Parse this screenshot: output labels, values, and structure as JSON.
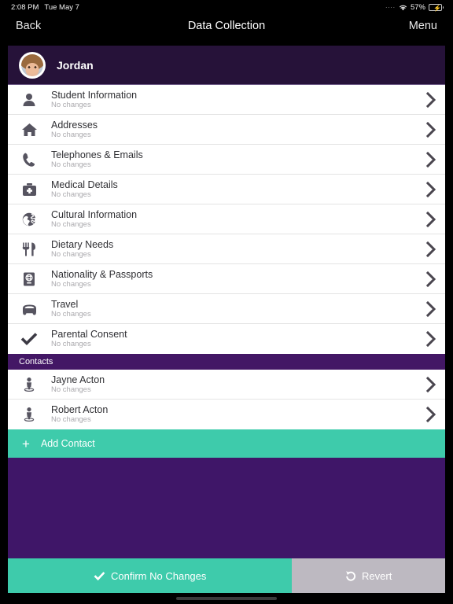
{
  "statusbar": {
    "time": "2:08 PM",
    "date": "Tue May 7",
    "signal_dots": "....",
    "wifi_icon": "wifi-icon",
    "battery_percent": "57%",
    "battery_level": 57,
    "battery_charging": true
  },
  "navbar": {
    "back_label": "Back",
    "title": "Data Collection",
    "menu_label": "Menu"
  },
  "profile": {
    "name": "Jordan",
    "avatar_alt": "student-photo"
  },
  "sections": [
    {
      "id": "details",
      "header": null,
      "rows": [
        {
          "icon": "person-icon",
          "title": "Student Information",
          "subtitle": "No changes"
        },
        {
          "icon": "home-icon",
          "title": "Addresses",
          "subtitle": "No changes"
        },
        {
          "icon": "phone-icon",
          "title": "Telephones & Emails",
          "subtitle": "No changes"
        },
        {
          "icon": "medkit-icon",
          "title": "Medical Details",
          "subtitle": "No changes"
        },
        {
          "icon": "globe-icon",
          "title": "Cultural Information",
          "subtitle": "No changes"
        },
        {
          "icon": "cutlery-icon",
          "title": "Dietary Needs",
          "subtitle": "No changes"
        },
        {
          "icon": "passport-icon",
          "title": "Nationality & Passports",
          "subtitle": "No changes"
        },
        {
          "icon": "car-icon",
          "title": "Travel",
          "subtitle": "No changes"
        },
        {
          "icon": "check-icon",
          "title": "Parental Consent",
          "subtitle": "No changes"
        }
      ]
    },
    {
      "id": "contacts",
      "header": "Contacts",
      "rows": [
        {
          "icon": "contact-person-icon",
          "title": "Jayne Acton",
          "subtitle": "No changes"
        },
        {
          "icon": "contact-person-icon",
          "title": "Robert Acton",
          "subtitle": "No changes"
        }
      ]
    }
  ],
  "add_contact": {
    "label": "Add Contact",
    "icon": "plus-icon"
  },
  "actions": {
    "confirm": {
      "label": "Confirm No Changes",
      "icon": "check-icon"
    },
    "revert": {
      "label": "Revert",
      "icon": "undo-icon"
    }
  },
  "colors": {
    "brand_purple_dark": "#261239",
    "brand_purple": "#3f1668",
    "section_purple": "#431765",
    "accent_teal": "#3ecbab",
    "revert_gray": "#bdb9c1",
    "row_bg": "#ffffff",
    "battery_green": "#3ad24a"
  }
}
